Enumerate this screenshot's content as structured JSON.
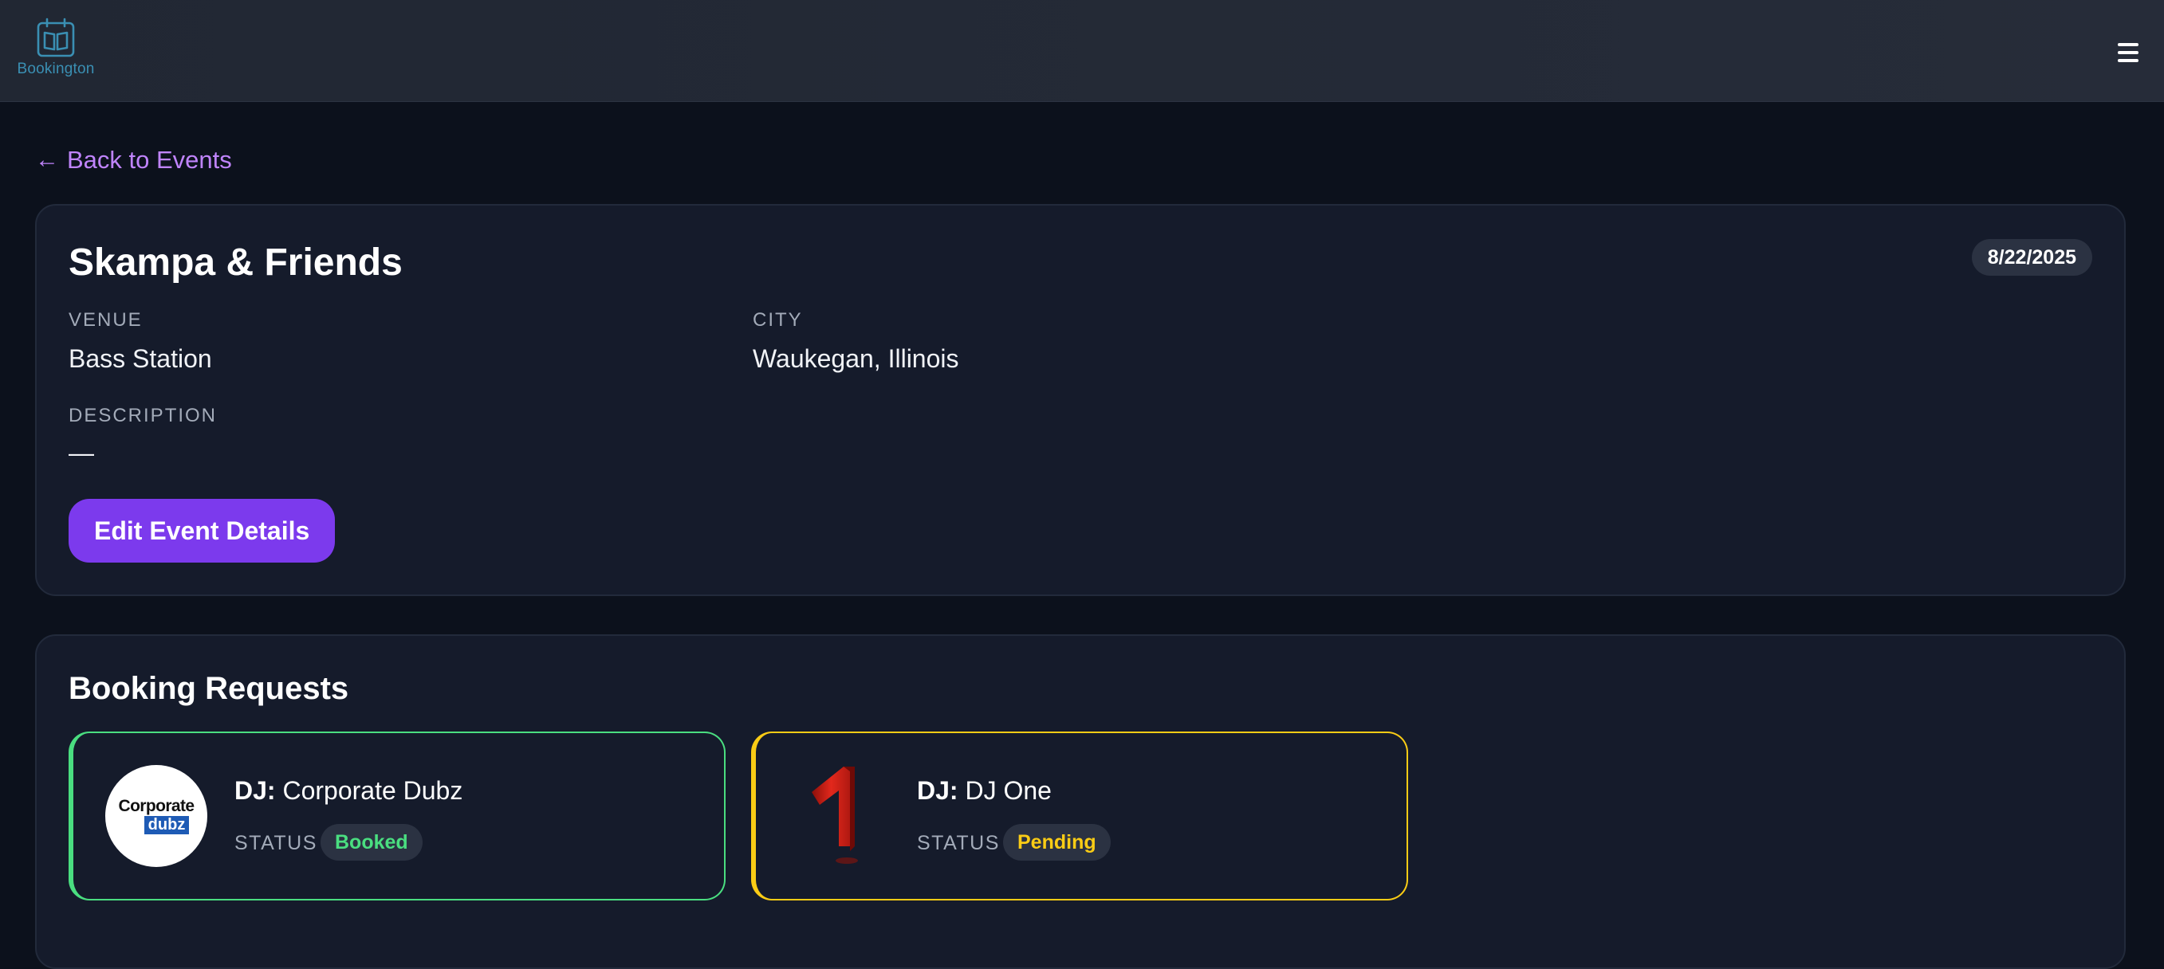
{
  "app": {
    "name": "Bookington",
    "brand_color": "#3a8fb3",
    "accent_color": "#7c3aed"
  },
  "nav": {
    "back_label": "Back to Events",
    "menu_icon": "hamburger-menu-icon"
  },
  "event": {
    "title": "Skampa & Friends",
    "date": "8/22/2025",
    "venue_label": "VENUE",
    "venue": "Bass Station",
    "city_label": "CITY",
    "city": "Waukegan, Illinois",
    "description_label": "DESCRIPTION",
    "description": "—",
    "edit_label": "Edit Event Details"
  },
  "bookings": {
    "title": "Booking Requests",
    "items": [
      {
        "dj_prefix": "DJ:",
        "dj_name": "Corporate Dubz",
        "status_label": "STATUS",
        "status": "Booked",
        "status_color": "#4ade80",
        "avatar_text_top": "Corporate",
        "avatar_text_bottom": "dubz"
      },
      {
        "dj_prefix": "DJ:",
        "dj_name": "DJ One",
        "status_label": "STATUS",
        "status": "Pending",
        "status_color": "#facc15",
        "avatar_icon": "red-number-one-logo"
      }
    ]
  }
}
